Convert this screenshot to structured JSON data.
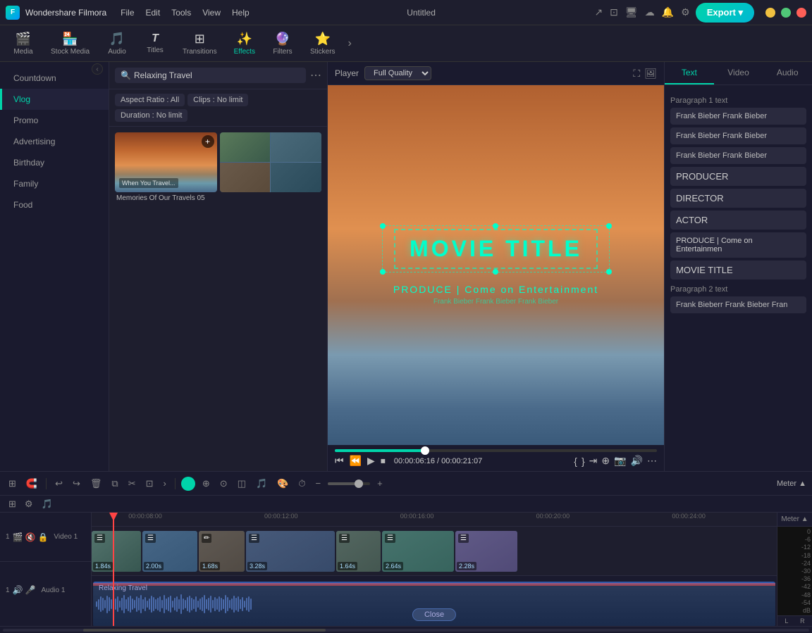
{
  "app": {
    "name": "Wondershare Filmora",
    "title": "Untitled",
    "logo": "F"
  },
  "menu": {
    "items": [
      "File",
      "Edit",
      "Tools",
      "View",
      "Help"
    ]
  },
  "toolbar": {
    "items": [
      {
        "id": "media",
        "label": "Media",
        "icon": "🎬"
      },
      {
        "id": "stock",
        "label": "Stock Media",
        "icon": "🏪"
      },
      {
        "id": "audio",
        "label": "Audio",
        "icon": "🎵"
      },
      {
        "id": "titles",
        "label": "Titles",
        "icon": "T"
      },
      {
        "id": "transitions",
        "label": "Transitions",
        "icon": "⊞"
      },
      {
        "id": "effects",
        "label": "Effects",
        "icon": "✨"
      },
      {
        "id": "filters",
        "label": "Filters",
        "icon": "🔮"
      },
      {
        "id": "stickers",
        "label": "Stickers",
        "icon": "⭐"
      }
    ],
    "export_label": "Export ▾"
  },
  "sidebar": {
    "items": [
      {
        "id": "countdown",
        "label": "Countdown",
        "active": false
      },
      {
        "id": "vlog",
        "label": "Vlog",
        "active": true
      },
      {
        "id": "promo",
        "label": "Promo",
        "active": false
      },
      {
        "id": "advertising",
        "label": "Advertising",
        "active": false
      },
      {
        "id": "birthday",
        "label": "Birthday",
        "active": false
      },
      {
        "id": "family",
        "label": "Family",
        "active": false
      },
      {
        "id": "food",
        "label": "Food",
        "active": false
      }
    ]
  },
  "media_browser": {
    "search_placeholder": "Relaxing Travel",
    "filters": {
      "aspect_ratio_label": "Aspect Ratio : All",
      "clips_label": "Clips : No limit",
      "duration_label": "Duration : No limit"
    },
    "items": [
      {
        "label": "Memories Of Our Travels 05",
        "type": "beach"
      },
      {
        "label": "",
        "type": "travel-grid"
      }
    ]
  },
  "player": {
    "label": "Player",
    "quality": "Full Quality",
    "movie_title": "MOVIE TITLE",
    "produce_text": "PRODUCE | Come on Entertainment",
    "credit_text": "Frank Bieber Frank Bieber Frank Bieber",
    "current_time": "00:00:06:16",
    "total_time": "00:00:21:07"
  },
  "right_panel": {
    "tabs": [
      "Text",
      "Video",
      "Audio"
    ],
    "active_tab": "Text",
    "paragraph1_label": "Paragraph 1 text",
    "text_cards": [
      "Frank Bieber Frank Bieber",
      "Frank Bieber Frank Bieber",
      "Frank Bieber Frank Bieber"
    ],
    "named_items": [
      {
        "name": "PRODUCER"
      },
      {
        "name": "DIRECTOR"
      },
      {
        "name": "ACTOR"
      },
      {
        "name": "PRODUCE | Come on Entertainmen"
      },
      {
        "name": "MOVIE TITLE"
      }
    ],
    "paragraph2_label": "Paragraph 2 text",
    "para2_cards": [
      "Frank Bieberr Frank Bieber Fran"
    ]
  },
  "timeline": {
    "tracks": [
      {
        "type": "video",
        "label": "Video 1",
        "num": "1",
        "clips": [
          {
            "duration": "1.84s",
            "color": "#4a6a7a"
          },
          {
            "duration": "2.00s",
            "color": "#5a7a6a"
          },
          {
            "duration": "1.68s",
            "color": "#6a5a7a"
          },
          {
            "duration": "3.28s",
            "color": "#4a5a7a"
          },
          {
            "duration": "1.64s",
            "color": "#5a6a7a"
          },
          {
            "duration": "2.64s",
            "color": "#4a7a6a"
          },
          {
            "duration": "2.28s",
            "color": "#6a7a5a"
          }
        ]
      },
      {
        "type": "audio",
        "label": "Audio 1",
        "num": "1",
        "audio_label": "Relaxing Travel",
        "close_btn": "Close"
      }
    ],
    "ruler_marks": [
      "00:00:08:00",
      "00:00:12:00",
      "00:00:16:00",
      "00:00:20:00",
      "00:00:24:00"
    ],
    "meter_label": "Meter ▲",
    "meter_marks": [
      "0",
      "-6",
      "-12",
      "-18",
      "-24",
      "-30",
      "-36",
      "-42",
      "-48",
      "-54"
    ],
    "db_label": "dB",
    "lr_labels": [
      "L",
      "R"
    ]
  },
  "window_controls": {
    "minimize": "—",
    "maximize": "□",
    "close": "✕"
  }
}
